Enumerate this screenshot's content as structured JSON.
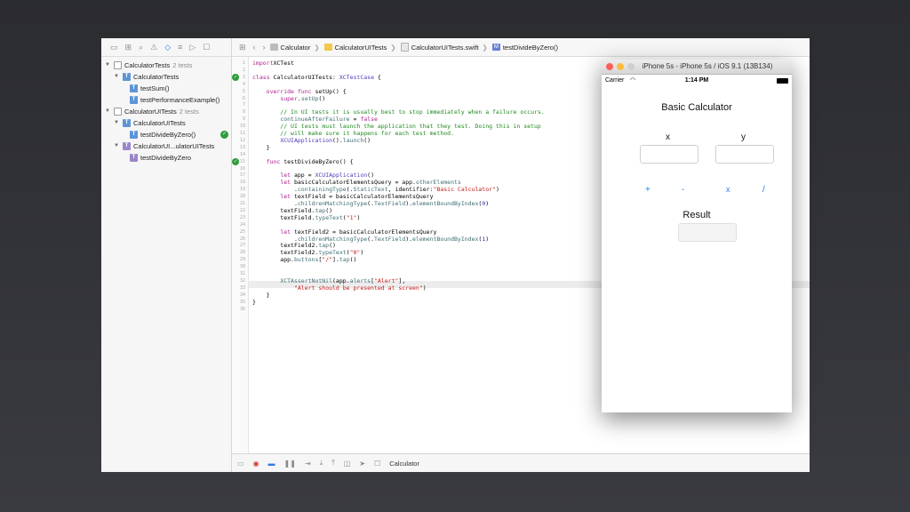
{
  "navigator": {
    "items": [
      {
        "label": "CalculatorTests",
        "sub": "2 tests"
      },
      {
        "label": "CalculatorTests"
      },
      {
        "label": "testSum()"
      },
      {
        "label": "testPerformanceExample()"
      },
      {
        "label": "CalculatorUITests",
        "sub": "2 tests"
      },
      {
        "label": "CalculatorUITests"
      },
      {
        "label": "testDivideByZero()"
      },
      {
        "label": "CalculatorUI...ulatorUITests"
      },
      {
        "label": "testDivideByZero"
      }
    ]
  },
  "breadcrumb": [
    "Calculator",
    "CalculatorUITests",
    "CalculatorUITests.swift",
    "testDivideByZero()"
  ],
  "code": {
    "line_numbers": [
      "1",
      "2",
      "3",
      "4",
      "5",
      "6",
      "7",
      "8",
      "9",
      "10",
      "11",
      "12",
      "13",
      "14",
      "15",
      "16",
      "17",
      "18",
      "19",
      "20",
      "21",
      "22",
      "23",
      "24",
      "25",
      "26",
      "27",
      "28",
      "29",
      "30",
      "31",
      "32",
      "33",
      "34",
      "35",
      "36"
    ],
    "lines": [
      {
        "t": [
          [
            "kw",
            "import"
          ],
          [
            "",
            "XCTest"
          ]
        ]
      },
      {
        "t": []
      },
      {
        "t": [
          [
            "kw",
            "class"
          ],
          [
            "",
            " CalculatorUITests: "
          ],
          [
            "ty",
            "XCTestCase"
          ],
          [
            "",
            " {"
          ]
        ]
      },
      {
        "t": []
      },
      {
        "t": [
          [
            "",
            "    "
          ],
          [
            "kw",
            "override func"
          ],
          [
            "",
            " setUp() {"
          ]
        ]
      },
      {
        "t": [
          [
            "",
            "        "
          ],
          [
            "kw",
            "super"
          ],
          [
            ".",
            "."
          ],
          [
            "fn",
            "setUp"
          ],
          [
            "",
            "()"
          ]
        ]
      },
      {
        "t": []
      },
      {
        "t": [
          [
            "cm",
            "        // In UI tests it is usually best to stop immediately when a failure occurs."
          ]
        ]
      },
      {
        "t": [
          [
            "",
            "        "
          ],
          [
            "fn",
            "continueAfterFailure"
          ],
          [
            "",
            " = "
          ],
          [
            "kw",
            "false"
          ]
        ]
      },
      {
        "t": [
          [
            "cm",
            "        // UI tests must launch the application that they test. Doing this in setup"
          ]
        ]
      },
      {
        "t": [
          [
            "cm",
            "        // will make sure it happens for each test method."
          ]
        ]
      },
      {
        "t": [
          [
            "",
            "        "
          ],
          [
            "ty",
            "XCUIApplication"
          ],
          [
            "",
            "()."
          ],
          [
            "fn",
            "launch"
          ],
          [
            "",
            "()"
          ]
        ]
      },
      {
        "t": [
          [
            "",
            "    }"
          ]
        ]
      },
      {
        "t": []
      },
      {
        "t": [
          [
            "",
            "    "
          ],
          [
            "kw",
            "func"
          ],
          [
            "",
            " testDivideByZero() {"
          ]
        ]
      },
      {
        "t": []
      },
      {
        "t": [
          [
            "",
            "        "
          ],
          [
            "kw",
            "let"
          ],
          [
            "",
            " app = "
          ],
          [
            "ty",
            "XCUIApplication"
          ],
          [
            "",
            "()"
          ]
        ]
      },
      {
        "t": [
          [
            "",
            "        "
          ],
          [
            "kw",
            "let"
          ],
          [
            "",
            " basicCalculatorElementsQuery = app."
          ],
          [
            "fn",
            "otherElements"
          ]
        ]
      },
      {
        "t": [
          [
            "",
            "            ."
          ],
          [
            "fn",
            "containingType"
          ],
          [
            "",
            "(."
          ],
          [
            "fn",
            "StaticText"
          ],
          [
            "",
            ", identifier:"
          ],
          [
            "str",
            "\"Basic Calculator\""
          ],
          [
            "",
            ")"
          ]
        ]
      },
      {
        "t": [
          [
            "",
            "        "
          ],
          [
            "kw",
            "let"
          ],
          [
            "",
            " textField = basicCalculatorElementsQuery"
          ]
        ]
      },
      {
        "t": [
          [
            "",
            "            ."
          ],
          [
            "fn",
            "childrenMatchingType"
          ],
          [
            "",
            "(."
          ],
          [
            "fn",
            "TextField"
          ],
          [
            "",
            ")."
          ],
          [
            "fn",
            "elementBoundByIndex"
          ],
          [
            "",
            "("
          ],
          [
            "num",
            "0"
          ],
          [
            "",
            ")"
          ]
        ]
      },
      {
        "t": [
          [
            "",
            "        textField."
          ],
          [
            "fn",
            "tap"
          ],
          [
            "",
            "()"
          ]
        ]
      },
      {
        "t": [
          [
            "",
            "        textField."
          ],
          [
            "fn",
            "typeText"
          ],
          [
            "",
            "("
          ],
          [
            "str",
            "\"1\""
          ],
          [
            "",
            ")"
          ]
        ]
      },
      {
        "t": []
      },
      {
        "t": [
          [
            "",
            "        "
          ],
          [
            "kw",
            "let"
          ],
          [
            "",
            " textField2 = basicCalculatorElementsQuery"
          ]
        ]
      },
      {
        "t": [
          [
            "",
            "            ."
          ],
          [
            "fn",
            "childrenMatchingType"
          ],
          [
            "",
            "(."
          ],
          [
            "fn",
            "TextField"
          ],
          [
            "",
            ")."
          ],
          [
            "fn",
            "elementBoundByIndex"
          ],
          [
            "",
            "("
          ],
          [
            "num",
            "1"
          ],
          [
            "",
            ")"
          ]
        ]
      },
      {
        "t": [
          [
            "",
            "        textField2."
          ],
          [
            "fn",
            "tap"
          ],
          [
            "",
            "()"
          ]
        ]
      },
      {
        "t": [
          [
            "",
            "        textField2."
          ],
          [
            "fn",
            "typeText"
          ],
          [
            "",
            "("
          ],
          [
            "str",
            "\"0\""
          ],
          [
            "",
            ")"
          ]
        ]
      },
      {
        "t": [
          [
            "",
            "        app."
          ],
          [
            "fn",
            "buttons"
          ],
          [
            "",
            "["
          ],
          [
            "str",
            "\"/\""
          ],
          [
            "",
            "]."
          ],
          [
            "fn",
            "tap"
          ],
          [
            "",
            "()"
          ]
        ]
      },
      {
        "t": []
      },
      {
        "t": []
      },
      {
        "t": [
          [
            "",
            "        "
          ],
          [
            "fn",
            "XCTAssertNotNil"
          ],
          [
            "",
            "(app."
          ],
          [
            "fn",
            "alerts"
          ],
          [
            "",
            "["
          ],
          [
            "str",
            "\"Alert\""
          ],
          [
            "",
            "],"
          ]
        ]
      },
      {
        "t": [
          [
            "",
            "            "
          ],
          [
            "str",
            "\"Alert should be presented at screen\""
          ],
          [
            "",
            ")"
          ]
        ]
      },
      {
        "t": [
          [
            "",
            "    }"
          ]
        ]
      },
      {
        "t": [
          [
            "",
            "}"
          ]
        ]
      },
      {
        "t": []
      }
    ]
  },
  "debug": {
    "scheme_label": "Calculator"
  },
  "simulator": {
    "window_title": "iPhone 5s - iPhone 5s / iOS 9.1 (13B134)",
    "carrier": "Carrier",
    "time": "1:14 PM",
    "app_title": "Basic Calculator",
    "x_label": "x",
    "y_label": "y",
    "ops": [
      "+",
      "-",
      "x",
      "/"
    ],
    "result_label": "Result"
  },
  "colors": {
    "accent": "#1e7cf2",
    "pass": "#2f9c3b"
  }
}
